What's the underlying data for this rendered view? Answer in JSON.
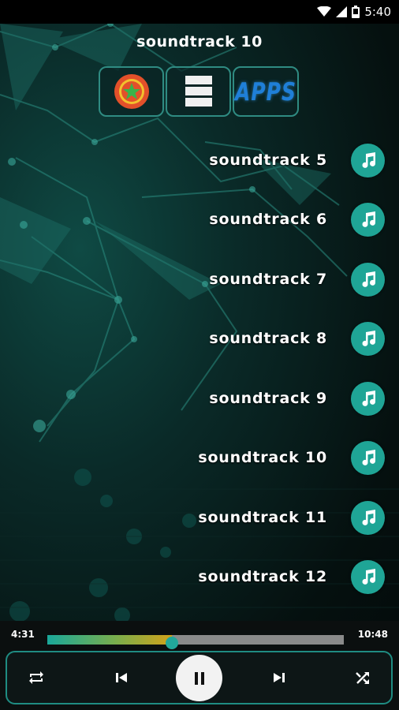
{
  "status_bar": {
    "time": "5:40",
    "icons": [
      "wifi-icon",
      "signal-icon",
      "battery-icon"
    ]
  },
  "now_playing": {
    "title": "soundtrack  10"
  },
  "top_buttons": [
    {
      "name": "favorites-button",
      "icon": "star-badge-icon"
    },
    {
      "name": "playlist-button",
      "icon": "list-icon"
    },
    {
      "name": "apps-button",
      "label": "APPS"
    }
  ],
  "tracks": [
    {
      "label": "soundtrack  5"
    },
    {
      "label": "soundtrack  6"
    },
    {
      "label": "soundtrack  7"
    },
    {
      "label": "soundtrack  8"
    },
    {
      "label": "soundtrack  9"
    },
    {
      "label": "soundtrack  10"
    },
    {
      "label": "soundtrack  11"
    },
    {
      "label": "soundtrack  12"
    }
  ],
  "player": {
    "elapsed": "4:31",
    "duration": "10:48",
    "progress": 0.42,
    "controls": [
      "repeat-icon",
      "previous-icon",
      "pause-icon",
      "next-icon",
      "shuffle-icon"
    ]
  },
  "colors": {
    "accent": "#1fa596",
    "border": "#2f8b82",
    "apps_text": "#1f7fd8"
  }
}
